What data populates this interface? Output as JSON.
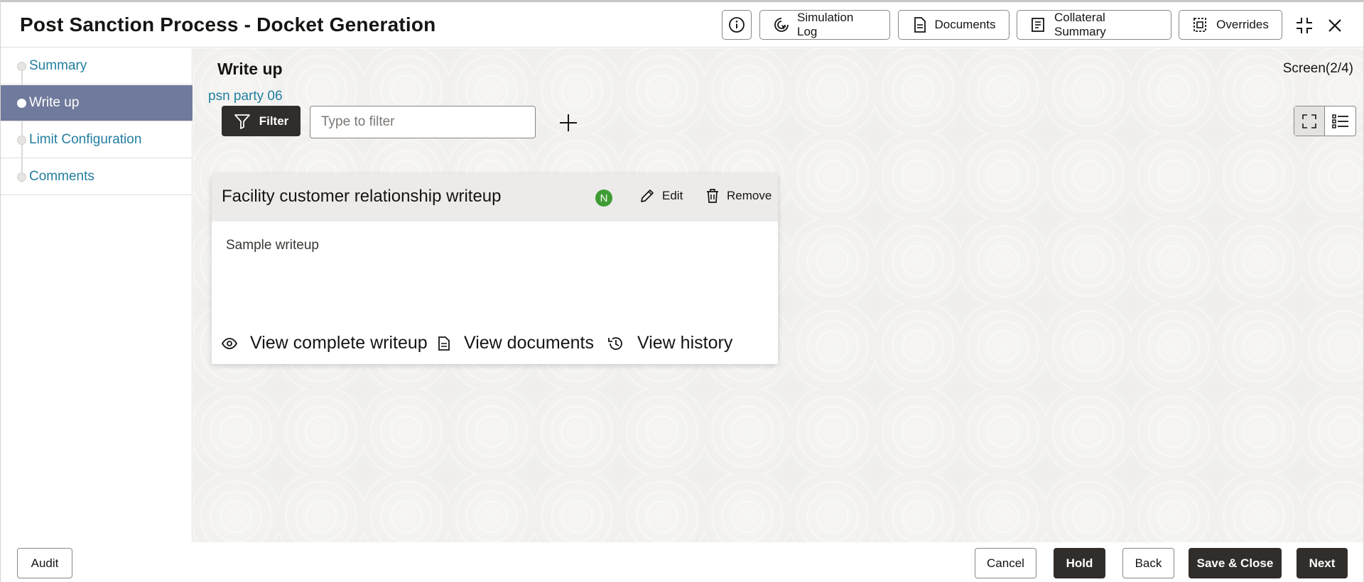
{
  "header": {
    "title": "Post Sanction Process - Docket Generation",
    "buttons": {
      "info_icon": "info-icon",
      "simulation_log": "Simulation Log",
      "documents": "Documents",
      "collateral_summary": "Collateral Summary",
      "overrides": "Overrides"
    }
  },
  "sidebar": {
    "items": [
      {
        "label": "Summary"
      },
      {
        "label": "Write up"
      },
      {
        "label": "Limit Configuration"
      },
      {
        "label": "Comments"
      }
    ],
    "active_index": 1
  },
  "main": {
    "section_title": "Write up",
    "screen_count": "Screen(2/4)",
    "party_name": "psn party 06",
    "filter": {
      "button_label": "Filter",
      "placeholder": "Type to filter",
      "value": ""
    },
    "card": {
      "title": "Facility customer relationship writeup",
      "badge": "N",
      "edit_label": "Edit",
      "remove_label": "Remove",
      "body": "Sample writeup",
      "links": {
        "view_complete": "View complete writeup",
        "view_documents": "View documents",
        "view_history": "View history"
      }
    }
  },
  "footer": {
    "audit": "Audit",
    "cancel": "Cancel",
    "hold": "Hold",
    "back": "Back",
    "save_close": "Save & Close",
    "next": "Next"
  },
  "colors": {
    "active_nav": "#6f7a9c",
    "link": "#227e9e",
    "dark_button": "#312d2a",
    "badge_green": "#3f9c35"
  }
}
